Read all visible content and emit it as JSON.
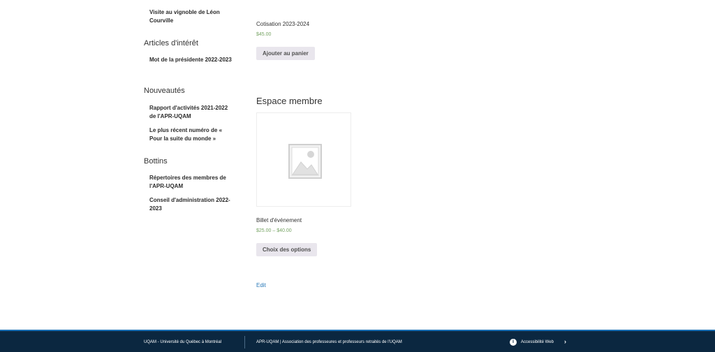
{
  "sidebar": {
    "top_link": "Visite au vignoble de Léon Courville",
    "sections": [
      {
        "heading": "Articles d'intérêt",
        "links": [
          "Mot de la présidente 2022-2023"
        ]
      },
      {
        "heading": "Nouveautés",
        "links": [
          "Rapport d'activités 2021-2022 de l'APR-UQAM",
          "Le plus récent numéro de « Pour la suite du monde »"
        ]
      },
      {
        "heading": "Bottins",
        "links": [
          "Répertoires des membres de l'APR-UQAM",
          "Conseil d'administration 2022-2023"
        ]
      }
    ]
  },
  "main": {
    "product1": {
      "name": "Cotisation 2023-2024",
      "price": "$45.00",
      "button": "Ajouter au panier"
    },
    "section_title": "Espace membre",
    "product2": {
      "name": "Billet d'événement",
      "price": "$25.00 – $40.00",
      "button": "Choix des options",
      "image_icon": "image-placeholder-icon"
    },
    "edit_label": "Edit"
  },
  "footer": {
    "left": "UQAM - Université du Québec à Montréal",
    "middle": "APR-UQAM | Association des professeures et professeurs retraités de l'UQAM",
    "accessibility": "Accessibilité Web",
    "accessibility_icon": "info-icon",
    "chevron_icon": "chevron-right-icon"
  },
  "colors": {
    "price": "#77a464",
    "button_bg": "#e9e6ed",
    "footer_bg": "#0b2740",
    "footer_border": "#1a6fb5",
    "link": "#2a7ab8"
  }
}
